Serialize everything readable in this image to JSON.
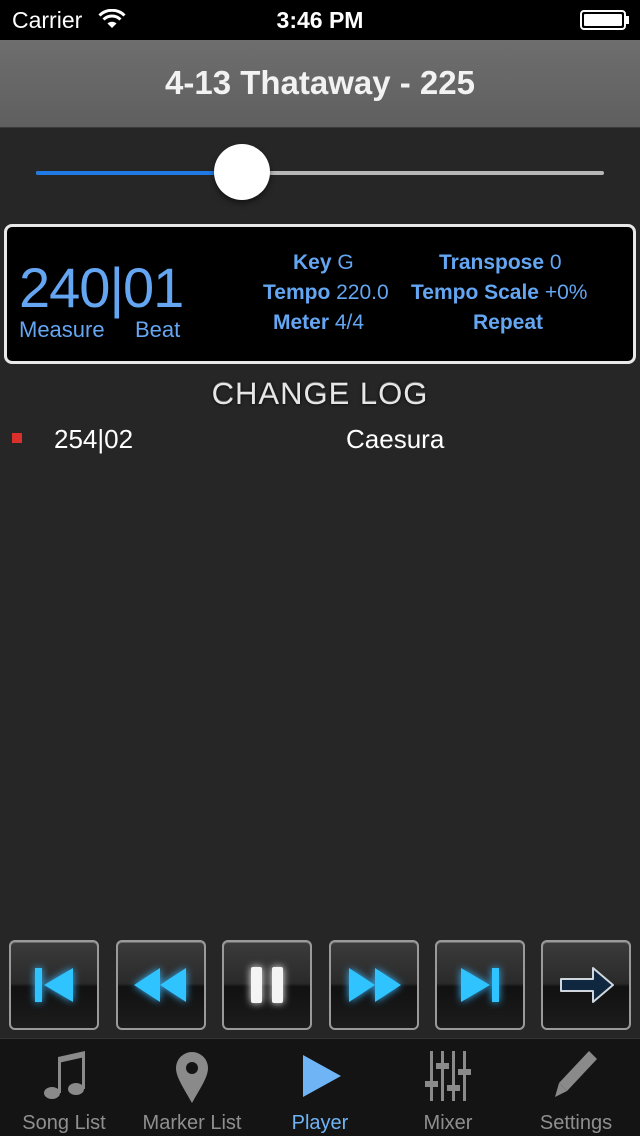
{
  "status_bar": {
    "carrier": "Carrier",
    "time": "3:46 PM"
  },
  "header": {
    "title": "4-13 Thataway - 225"
  },
  "slider": {
    "position_fraction": 0.363
  },
  "position": {
    "measure_value": "240",
    "separator": "|",
    "beat_value": "01",
    "measure_label": "Measure",
    "beat_label": "Beat"
  },
  "info": {
    "key_label": "Key",
    "key_value": "G",
    "tempo_label": "Tempo",
    "tempo_value": "220.0",
    "meter_label": "Meter",
    "meter_value": "4/4",
    "transpose_label": "Transpose",
    "transpose_value": "0",
    "tempo_scale_label": "Tempo Scale",
    "tempo_scale_value": "+0%",
    "repeat_label": "Repeat"
  },
  "change_log": {
    "title": "CHANGE LOG",
    "entries": [
      {
        "position": "254|02",
        "event": "Caesura"
      }
    ]
  },
  "transport": {
    "buttons": [
      "skip-to-start",
      "rewind",
      "pause",
      "fast-forward",
      "skip-to-end",
      "next-arrow"
    ]
  },
  "tabs": [
    {
      "label": "Song List",
      "icon": "music-note-icon"
    },
    {
      "label": "Marker List",
      "icon": "map-pin-icon"
    },
    {
      "label": "Player",
      "icon": "play-icon",
      "active": true
    },
    {
      "label": "Mixer",
      "icon": "sliders-icon"
    },
    {
      "label": "Settings",
      "icon": "pencil-icon"
    }
  ],
  "colors": {
    "accent": "#64a6f2",
    "slider_fill": "#1f7ae6",
    "log_bullet": "#d9302c",
    "tab_active": "#6fb4f5"
  }
}
